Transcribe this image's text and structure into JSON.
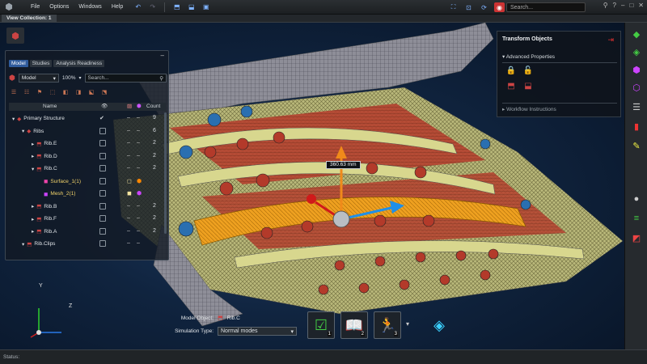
{
  "menu": {
    "file": "File",
    "options": "Options",
    "windows": "Windows",
    "help": "Help"
  },
  "search": {
    "placeholder": "Search..."
  },
  "view_collection_tab": "View Collection: 1",
  "browser": {
    "tabs": [
      "Model",
      "Studies",
      "Analysis Readiness"
    ],
    "filter_value": "Model",
    "zoom": "100%",
    "search_placeholder": "Search...",
    "columns": {
      "name": "Name",
      "count": "Count"
    },
    "rows": [
      {
        "label": "Primary Structure",
        "indent": 0,
        "count": "9",
        "vis": "✔"
      },
      {
        "label": "Ribs",
        "indent": 1,
        "count": "6",
        "vis": "chk"
      },
      {
        "label": "Rib.E",
        "indent": 2,
        "count": "2",
        "vis": "chk"
      },
      {
        "label": "Rib.D",
        "indent": 2,
        "count": "2",
        "vis": "chk"
      },
      {
        "label": "Rib.C",
        "indent": 2,
        "count": "2",
        "vis": "chk"
      },
      {
        "label": "Surface_1(1)",
        "indent": 3,
        "count": "",
        "vis": "chk"
      },
      {
        "label": "Mesh_2(1)",
        "indent": 3,
        "count": "",
        "vis": "chk"
      },
      {
        "label": "Rib.B",
        "indent": 2,
        "count": "2",
        "vis": "chk"
      },
      {
        "label": "Rib.F",
        "indent": 2,
        "count": "2",
        "vis": "chk"
      },
      {
        "label": "Rib.A",
        "indent": 2,
        "count": "2",
        "vis": "chk"
      },
      {
        "label": "Rib.Clips",
        "indent": 1,
        "count": "",
        "vis": "chk"
      }
    ]
  },
  "transform": {
    "title": "Transform Objects",
    "advanced": "Advanced Properties",
    "workflow": "Workflow Instructions"
  },
  "dimension": "360.63 mm",
  "bottom": {
    "model_object_label": "Model Object:",
    "model_object_value": "Rib.C",
    "sim_type_label": "Simulation Type:",
    "sim_type_value": "Normal modes",
    "steps": [
      "1",
      "2",
      "3"
    ]
  },
  "triad": {
    "x": "Z",
    "y": "Y"
  },
  "status": "Status:",
  "colors": {
    "accent": "#2f5b9c",
    "gizmo_up": "#f08a1a",
    "gizmo_right": "#1f8fe8",
    "gizmo_left": "#d01a1a",
    "mesh_yellow": "#c9c88a",
    "selected_rib": "#f2a020"
  }
}
